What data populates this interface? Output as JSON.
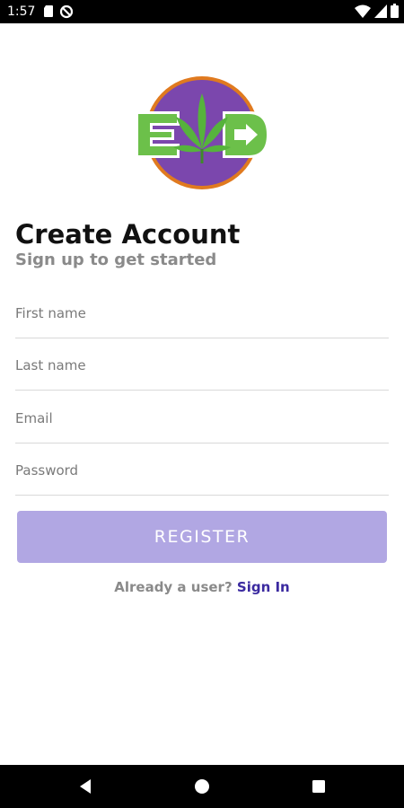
{
  "status_bar": {
    "time": "1:57",
    "left_icons": [
      "sd-card-icon",
      "blocked-circle-icon"
    ],
    "right_icons": [
      "wifi-icon",
      "cell-signal-icon",
      "battery-icon"
    ]
  },
  "logo": {
    "icon": "cannabis-leaf-logo-icon",
    "text": "E D",
    "colors": {
      "ring": "#e07a1f",
      "circle": "#7b47ad",
      "letters": "#6cc04a",
      "leaf": "#56b33c"
    }
  },
  "header": {
    "title": "Create Account",
    "subtitle": "Sign up to get started"
  },
  "form": {
    "first_name": {
      "placeholder": "First name",
      "value": ""
    },
    "last_name": {
      "placeholder": "Last name",
      "value": ""
    },
    "email": {
      "placeholder": "Email",
      "value": ""
    },
    "password": {
      "placeholder": "Password",
      "value": ""
    },
    "register_label": "REGISTER"
  },
  "signin": {
    "prompt": "Already a user?",
    "link": "Sign In"
  },
  "nav_bar": {
    "icons": [
      "back-icon",
      "home-icon",
      "recents-icon"
    ]
  },
  "colors": {
    "accent": "#b1a7e3",
    "link": "#3b2aa0",
    "muted_text": "#8a8a8a"
  }
}
